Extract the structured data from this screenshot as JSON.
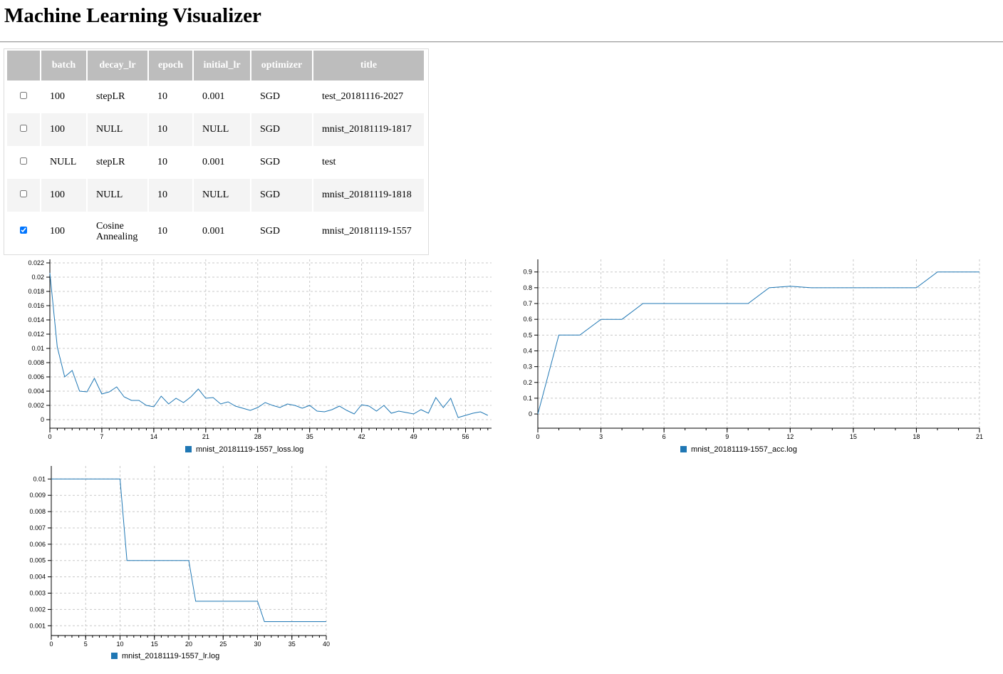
{
  "page": {
    "title": "Machine Learning Visualizer"
  },
  "table": {
    "columns": [
      "",
      "batch",
      "decay_lr",
      "epoch",
      "initial_lr",
      "optimizer",
      "title"
    ],
    "rows": [
      {
        "checked": false,
        "cells": [
          "100",
          "stepLR",
          "10",
          "0.001",
          "SGD",
          "test_20181116-2027"
        ]
      },
      {
        "checked": false,
        "cells": [
          "100",
          "NULL",
          "10",
          "NULL",
          "SGD",
          "mnist_20181119-1817"
        ]
      },
      {
        "checked": false,
        "cells": [
          "NULL",
          "stepLR",
          "10",
          "0.001",
          "SGD",
          "test"
        ]
      },
      {
        "checked": false,
        "cells": [
          "100",
          "NULL",
          "10",
          "NULL",
          "SGD",
          "mnist_20181119-1818"
        ]
      },
      {
        "checked": true,
        "cells": [
          "100",
          "Cosine\nAnnealing",
          "10",
          "0.001",
          "SGD",
          "mnist_20181119-1557"
        ]
      }
    ]
  },
  "chart_data": [
    {
      "type": "line",
      "legend": "mnist_20181119-1557_loss.log",
      "color": "#1f77b4",
      "xlim": [
        0,
        59.5
      ],
      "ylim": [
        -0.0012,
        0.0225
      ],
      "xticks": [
        0,
        7,
        14,
        21,
        28,
        35,
        42,
        49,
        56
      ],
      "yticks": [
        0,
        0.002,
        0.004,
        0.006,
        0.008,
        0.01,
        0.012,
        0.014,
        0.016,
        0.018,
        0.02,
        0.022
      ],
      "ytick_labels": [
        "0",
        "0.002",
        "0.004",
        "0.006",
        "0.008",
        "0.01",
        "0.012",
        "0.014",
        "0.016",
        "0.018",
        "0.02",
        "0.022"
      ],
      "grid": true,
      "x": [
        0,
        1,
        2,
        3,
        4,
        5,
        6,
        7,
        8,
        9,
        10,
        11,
        12,
        13,
        14,
        15,
        16,
        17,
        18,
        19,
        20,
        21,
        22,
        23,
        24,
        25,
        26,
        27,
        28,
        29,
        30,
        31,
        32,
        33,
        34,
        35,
        36,
        37,
        38,
        39,
        40,
        41,
        42,
        43,
        44,
        45,
        46,
        47,
        48,
        49,
        50,
        51,
        52,
        53,
        54,
        55,
        56,
        57,
        58,
        59
      ],
      "y": [
        0.0206,
        0.0102,
        0.006,
        0.0069,
        0.004,
        0.0039,
        0.0058,
        0.0036,
        0.0039,
        0.0046,
        0.0032,
        0.0027,
        0.0027,
        0.002,
        0.0018,
        0.0033,
        0.0022,
        0.003,
        0.0024,
        0.0032,
        0.0043,
        0.003,
        0.0031,
        0.0022,
        0.0025,
        0.0019,
        0.0016,
        0.0013,
        0.0017,
        0.0024,
        0.002,
        0.0017,
        0.0022,
        0.002,
        0.0016,
        0.002,
        0.0012,
        0.0011,
        0.0014,
        0.0019,
        0.0013,
        0.0008,
        0.0021,
        0.0019,
        0.0012,
        0.002,
        0.0009,
        0.0012,
        0.001,
        0.0008,
        0.0014,
        0.0009,
        0.0031,
        0.0017,
        0.003,
        0.0003,
        0.0006,
        0.0009,
        0.0011,
        0.0006
      ]
    },
    {
      "type": "line",
      "legend": "mnist_20181119-1557_acc.log",
      "color": "#1f77b4",
      "xlim": [
        0,
        21
      ],
      "ylim": [
        -0.09,
        0.98
      ],
      "xticks": [
        0,
        3,
        6,
        9,
        12,
        15,
        18,
        21
      ],
      "yticks": [
        0,
        0.1,
        0.2,
        0.3,
        0.4,
        0.5,
        0.6,
        0.7,
        0.8,
        0.9
      ],
      "ytick_labels": [
        "0",
        "0.1",
        "0.2",
        "0.3",
        "0.4",
        "0.5",
        "0.6",
        "0.7",
        "0.8",
        "0.9"
      ],
      "grid": true,
      "x": [
        0,
        1,
        2,
        3,
        4,
        5,
        6,
        7,
        8,
        9,
        10,
        11,
        12,
        13,
        14,
        15,
        16,
        17,
        18,
        19,
        20,
        21
      ],
      "y": [
        0,
        0.5,
        0.5,
        0.6,
        0.6,
        0.7,
        0.7,
        0.7,
        0.7,
        0.7,
        0.7,
        0.8,
        0.81,
        0.8,
        0.8,
        0.8,
        0.8,
        0.8,
        0.8,
        0.9,
        0.9,
        0.9
      ]
    },
    {
      "type": "line",
      "legend": "mnist_20181119-1557_lr.log",
      "color": "#1f77b4",
      "xlim": [
        0,
        40
      ],
      "ylim": [
        0.0004,
        0.0108
      ],
      "xticks": [
        0,
        5,
        10,
        15,
        20,
        25,
        30,
        35,
        40
      ],
      "yticks": [
        0.001,
        0.002,
        0.003,
        0.004,
        0.005,
        0.006,
        0.007,
        0.008,
        0.009,
        0.01
      ],
      "ytick_labels": [
        "0.001",
        "0.002",
        "0.003",
        "0.004",
        "0.005",
        "0.006",
        "0.007",
        "0.008",
        "0.009",
        "0.01"
      ],
      "grid": true,
      "x": [
        0,
        10,
        11,
        20,
        21,
        30,
        31,
        40
      ],
      "y": [
        0.01,
        0.01,
        0.005,
        0.005,
        0.0025,
        0.0025,
        0.00125,
        0.00125
      ]
    }
  ]
}
